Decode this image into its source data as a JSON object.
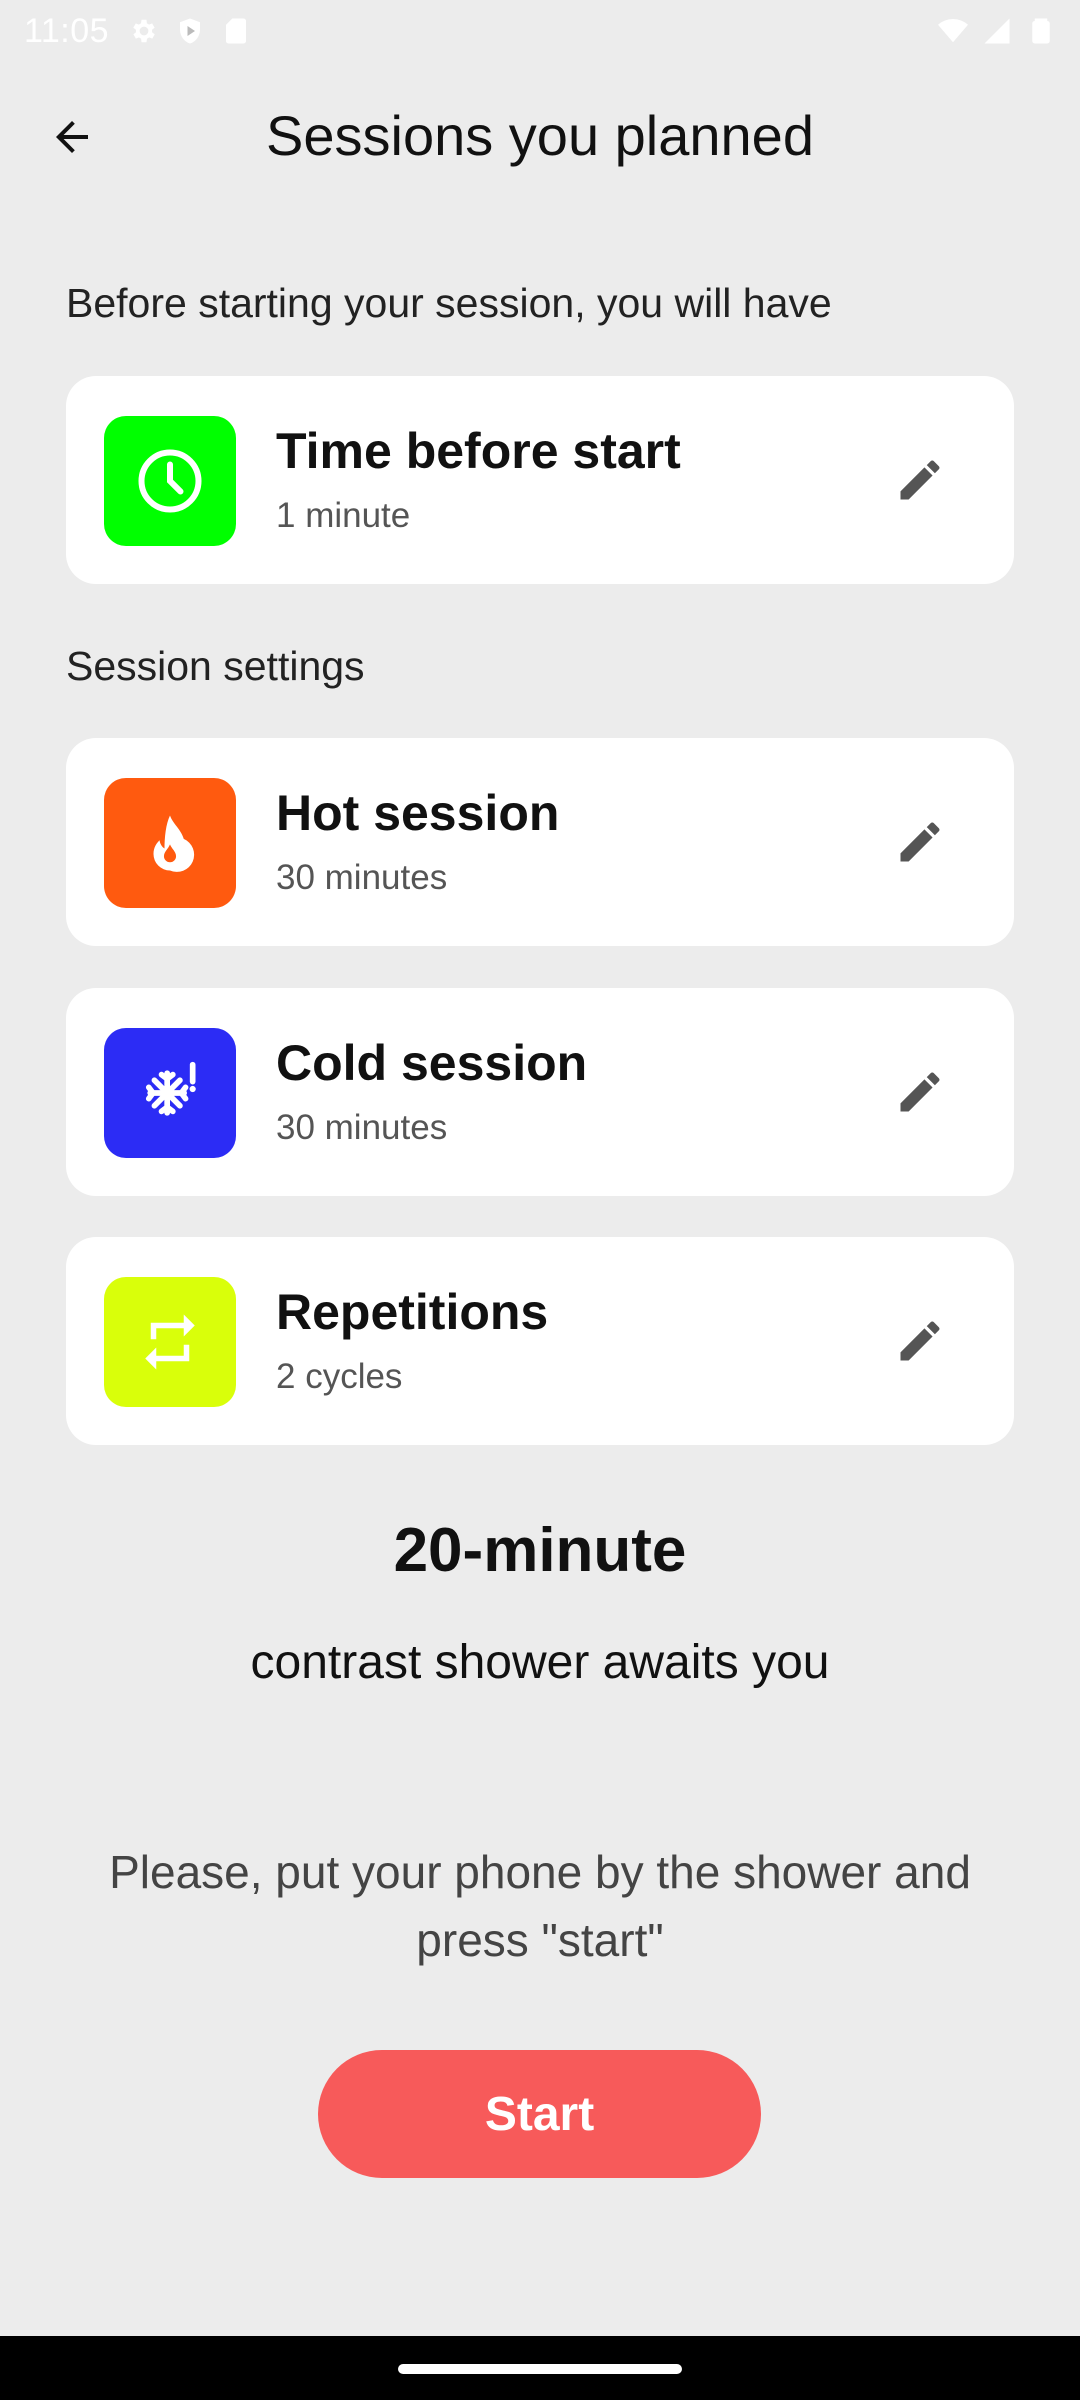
{
  "status_bar": {
    "time": "11:05",
    "left_icons": [
      "gear-icon",
      "shield-icon",
      "sd-card-icon"
    ],
    "right_icons": [
      "wifi-icon",
      "signal-icon",
      "battery-icon"
    ]
  },
  "header": {
    "title": "Sessions you planned"
  },
  "section_before": {
    "label": "Before starting your session, you will have"
  },
  "time_before_start": {
    "title": "Time before start",
    "value": "1 minute",
    "icon": "clock-icon",
    "color": "#00ff00"
  },
  "section_settings": {
    "label": "Session settings"
  },
  "settings": [
    {
      "title": "Hot session",
      "value": "30 minutes",
      "icon": "flame-icon",
      "color": "#ff5a0f"
    },
    {
      "title": "Cold session",
      "value": "30 minutes",
      "icon": "snowflake-icon",
      "color": "#2c2cf5"
    },
    {
      "title": "Repetitions",
      "value": "2 cycles",
      "icon": "repeat-icon",
      "color": "#d9ff0a"
    }
  ],
  "summary": {
    "duration": "20-minute",
    "text": "contrast shower awaits you"
  },
  "instructions": "Please, put your phone by the shower and press \"start\"",
  "start_button": {
    "label": "Start",
    "color": "#f75a5a"
  }
}
